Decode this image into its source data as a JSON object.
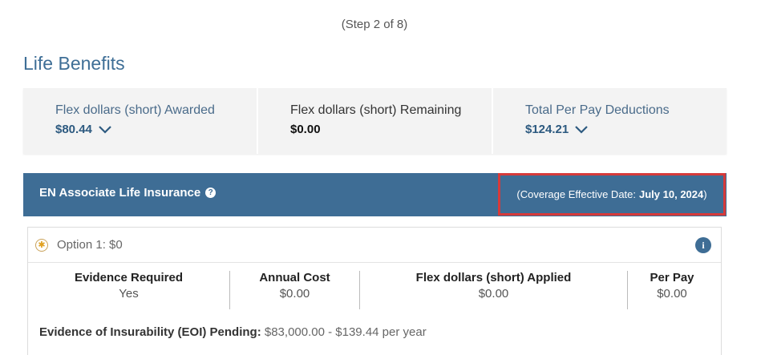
{
  "step_text": "(Step 2 of 8)",
  "page_title": "Life Benefits",
  "summary": [
    {
      "label": "Flex dollars (short) Awarded",
      "value": "$80.44",
      "expandable": true
    },
    {
      "label": "Flex dollars (short) Remaining",
      "value": "$0.00",
      "expandable": false
    },
    {
      "label": "Total Per Pay Deductions",
      "value": "$124.21",
      "expandable": true
    }
  ],
  "banner": {
    "title": "EN Associate Life Insurance",
    "help_icon": "?",
    "coverage_prefix": "(Coverage Effective Date:",
    "coverage_date": "July 10, 2024",
    "coverage_suffix": ")"
  },
  "option": {
    "label": "Option 1: $0",
    "info_icon": "i",
    "columns": [
      {
        "header": "Evidence Required",
        "value": "Yes"
      },
      {
        "header": "Annual Cost",
        "value": "$0.00"
      },
      {
        "header": "Flex dollars (short) Applied",
        "value": "$0.00"
      },
      {
        "header": "Per Pay",
        "value": "$0.00"
      }
    ],
    "eoi_label": "Evidence of Insurability (EOI) Pending:",
    "eoi_value": "$83,000.00 - $139.44 per year"
  },
  "colors": {
    "accent": "#3e6d95",
    "highlight": "#d63a3a"
  }
}
